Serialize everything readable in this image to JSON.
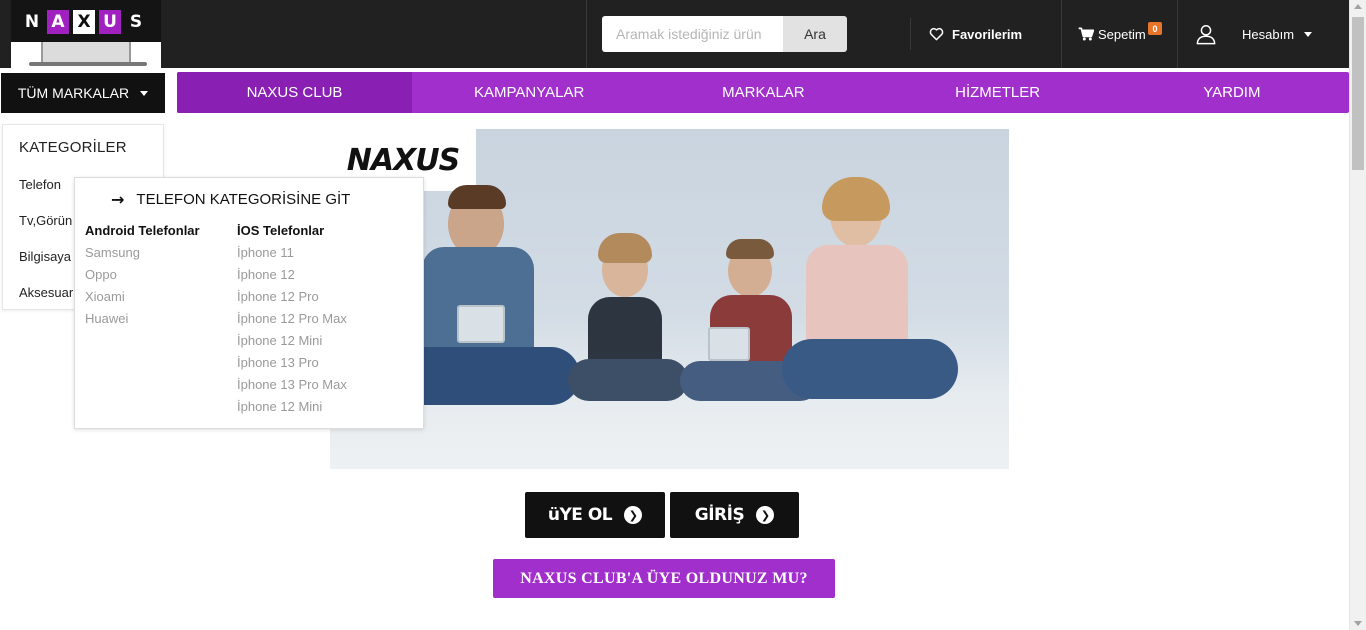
{
  "brand": {
    "logo_letters": [
      "N",
      "A",
      "X",
      "U",
      "S"
    ],
    "hero_logo_text": "NAXUS"
  },
  "header": {
    "search": {
      "placeholder": "Aramak istediğiniz ürün",
      "value": "",
      "button_label": "Ara"
    },
    "favorites_label": "Favorilerim",
    "cart_label": "Sepetim",
    "cart_count": "0",
    "account_label": "Hesabım",
    "icons": {
      "favorites": "heart-icon",
      "cart": "cart-icon",
      "account": "user-icon",
      "account_menu": "caret-down-icon"
    }
  },
  "nav": {
    "all_brands_label": "TÜM MARKALAR",
    "items": [
      {
        "label": "NAXUS CLUB",
        "active": true
      },
      {
        "label": "KAMPANYALAR",
        "active": false
      },
      {
        "label": "MARKALAR",
        "active": false
      },
      {
        "label": "HİZMETLER",
        "active": false
      },
      {
        "label": "YARDIM",
        "active": false
      }
    ]
  },
  "categories": {
    "title": "KATEGORİLER",
    "items": [
      "Telefon",
      "Tv,Görün",
      "Bilgisaya",
      "Aksesuar"
    ]
  },
  "submenu": {
    "goto_label": "TELEFON KATEGORİSİNE GİT",
    "android": {
      "title": "Android Telefonlar",
      "items": [
        "Samsung",
        "Oppo",
        "Xioami",
        "Huawei"
      ]
    },
    "ios": {
      "title": "İOS Telefonlar",
      "items": [
        "İphone 11",
        "İphone 12",
        "İphone 12 Pro",
        "İphone 12 Pro Max",
        "İphone 12 Mini",
        "İphone 13 Pro",
        "İphone 13 Pro Max",
        "İphone 12 Mini"
      ]
    }
  },
  "actions": {
    "register_label": "üYE OL",
    "login_label": "GİRİŞ",
    "club_label": "NAXUS CLUB'A ÜYE OLDUNUZ MU?"
  },
  "colors": {
    "accent_purple": "#a12fcb",
    "active_purple": "#8a20b3",
    "header_dark": "#212121",
    "badge_orange": "#e8742a"
  }
}
